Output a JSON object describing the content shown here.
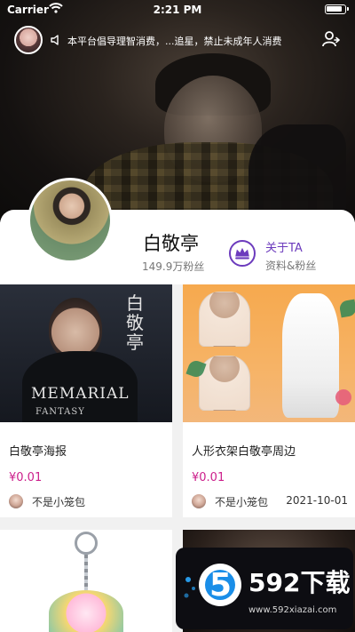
{
  "status_bar": {
    "carrier": "Carrier",
    "time": "2:21 PM"
  },
  "header": {
    "notice": "本平台倡导理智消费，...追星，禁止未成年人消费"
  },
  "profile": {
    "name": "白敬亭",
    "fans": "149.9万粉丝",
    "about_title": "关于TA",
    "about_subtitle": "资料&粉丝"
  },
  "cards": [
    {
      "title": "白敬亭海报",
      "price": "¥0.01",
      "seller": "不是小笼包",
      "date": "",
      "poster_cn": "白敬亭",
      "poster_line1": "MEMARIAL",
      "poster_line2": "FANTASY"
    },
    {
      "title": "人形衣架白敬亭周边",
      "price": "¥0.01",
      "seller": "不是小笼包",
      "date": "2021-10-01"
    }
  ],
  "watermark": {
    "main": "592下载",
    "sub": "www.592xiazai.com"
  },
  "colors": {
    "accent": "#6c3bbd",
    "price": "#cc1f8b"
  }
}
